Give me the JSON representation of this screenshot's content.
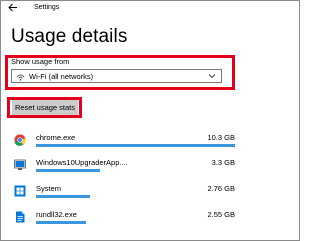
{
  "window": {
    "title": "Settings"
  },
  "page": {
    "title": "Usage details"
  },
  "usage_from": {
    "label": "Show usage from",
    "selected": "Wi-Fi (all networks)"
  },
  "reset_button": {
    "label": "Reset usage stats"
  },
  "apps": [
    {
      "name": "chrome.exe",
      "size": "10.3 GB",
      "usage_fraction": 1.0,
      "icon": "chrome-icon"
    },
    {
      "name": "Windows10UpgraderApp....",
      "size": "3.3 GB",
      "usage_fraction": 0.32,
      "icon": "windows-upgrader-icon"
    },
    {
      "name": "System",
      "size": "2.76 GB",
      "usage_fraction": 0.27,
      "icon": "windows-logo-icon"
    },
    {
      "name": "rundll32.exe",
      "size": "2.55 GB",
      "usage_fraction": 0.25,
      "icon": "document-icon"
    }
  ],
  "colors": {
    "highlight": "#e3001b",
    "bar": "#3a96dd",
    "button_bg": "#cccccc",
    "windows_blue": "#0078d7"
  }
}
